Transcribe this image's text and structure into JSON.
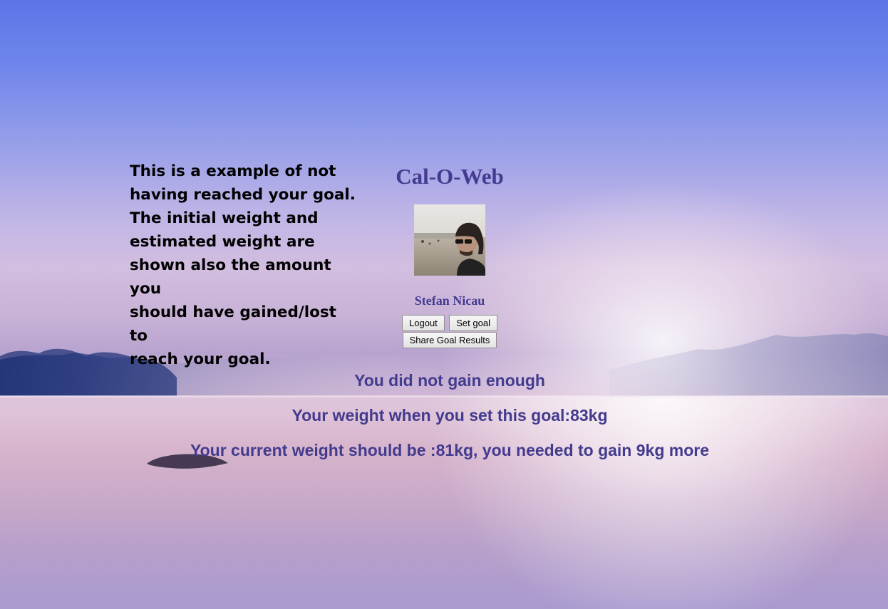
{
  "description": {
    "line1": "This is a example of not",
    "line2": "having reached your goal.",
    "line3": "The initial weight and",
    "line4": "estimated weight are",
    "line5": "shown also the amount you",
    "line6": "should have gained/lost to",
    "line7": "reach your goal."
  },
  "header": {
    "title": "Cal-O-Web"
  },
  "user": {
    "name": "Stefan Nicau"
  },
  "buttons": {
    "logout": "Logout",
    "set_goal": "Set goal",
    "share": "Share Goal Results"
  },
  "results": {
    "status": "You did not gain enough",
    "initial_weight": "Your weight when you set this goal:83kg",
    "current_weight": "Your current weight should be :81kg, you needed to gain 9kg more"
  }
}
